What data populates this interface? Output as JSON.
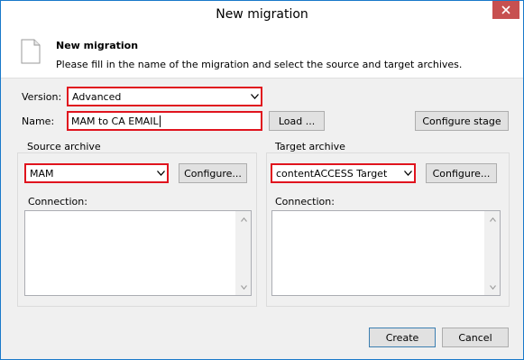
{
  "window": {
    "title": "New migration"
  },
  "header": {
    "title": "New migration",
    "description": "Please fill in the name of the migration and select the source and target archives.",
    "icon": "document-icon"
  },
  "form": {
    "version_label": "Version:",
    "version_value": "Advanced",
    "name_label": "Name:",
    "name_value": "MAM to CA EMAIL",
    "load_button": "Load ...",
    "configure_stage_button": "Configure stage"
  },
  "source": {
    "group_title": "Source archive",
    "archive_value": "MAM",
    "configure_button": "Configure...",
    "connection_label": "Connection:"
  },
  "target": {
    "group_title": "Target archive",
    "archive_value": "contentACCESS Target",
    "configure_button": "Configure...",
    "connection_label": "Connection:"
  },
  "footer": {
    "create_button": "Create",
    "cancel_button": "Cancel"
  },
  "colors": {
    "highlight_border": "#e0141e",
    "close_button": "#c75050",
    "window_border": "#1979ca"
  }
}
